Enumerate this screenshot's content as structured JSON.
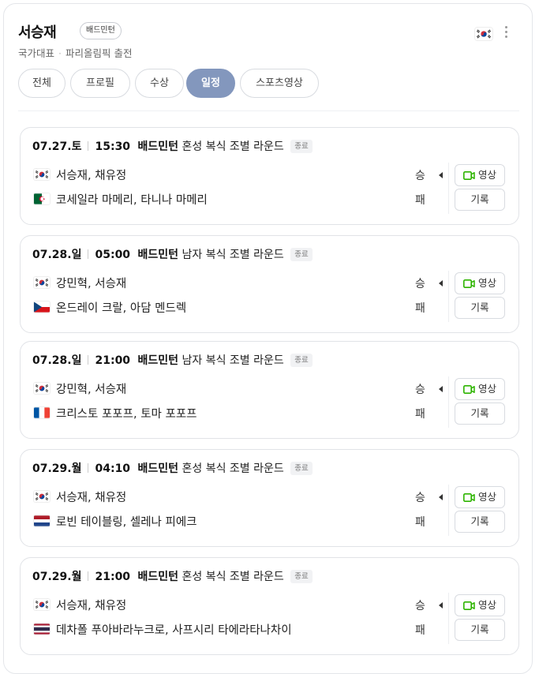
{
  "profile": {
    "name": "서승재",
    "sport_badge": "배드민턴",
    "subtitle_1": "국가대표",
    "subtitle_2": "파리올림픽 출전",
    "flag": "kr-flag-icon",
    "menu_icon": "more-vertical-icon"
  },
  "tabs": [
    {
      "label": "전체",
      "active": false
    },
    {
      "label": "프로필",
      "active": false
    },
    {
      "label": "수상",
      "active": false
    },
    {
      "label": "일정",
      "active": true
    },
    {
      "label": "스포츠영상",
      "active": false
    }
  ],
  "colors": {
    "accent": "#8397bd",
    "video_icon": "#2db400"
  },
  "matches": [
    {
      "date": "07.27.토",
      "time": "15:30",
      "sport": "배드민턴",
      "event": "혼성 복식 조별 라운드",
      "status": "종료",
      "team1": {
        "flag": "kr-flag-icon",
        "players": "서승재, 채유정",
        "result": "승"
      },
      "team2": {
        "flag": "dz-flag-icon",
        "players": "코세일라 마메리, 타니나 마메리",
        "result": "패"
      },
      "video_label": "영상",
      "record_label": "기록"
    },
    {
      "date": "07.28.일",
      "time": "05:00",
      "sport": "배드민턴",
      "event": "남자 복식 조별 라운드",
      "status": "종료",
      "team1": {
        "flag": "kr-flag-icon",
        "players": "강민혁, 서승재",
        "result": "승"
      },
      "team2": {
        "flag": "cz-flag-icon",
        "players": "온드레이 크랄, 아담 멘드렉",
        "result": "패"
      },
      "video_label": "영상",
      "record_label": "기록"
    },
    {
      "date": "07.28.일",
      "time": "21:00",
      "sport": "배드민턴",
      "event": "남자 복식 조별 라운드",
      "status": "종료",
      "team1": {
        "flag": "kr-flag-icon",
        "players": "강민혁, 서승재",
        "result": "승"
      },
      "team2": {
        "flag": "fr-flag-icon",
        "players": "크리스토 포포프, 토마 포포프",
        "result": "패"
      },
      "video_label": "영상",
      "record_label": "기록"
    },
    {
      "date": "07.29.월",
      "time": "04:10",
      "sport": "배드민턴",
      "event": "혼성 복식 조별 라운드",
      "status": "종료",
      "team1": {
        "flag": "kr-flag-icon",
        "players": "서승재, 채유정",
        "result": "승"
      },
      "team2": {
        "flag": "nl-flag-icon",
        "players": "로빈 테이블링, 셀레나 피에크",
        "result": "패"
      },
      "video_label": "영상",
      "record_label": "기록"
    },
    {
      "date": "07.29.월",
      "time": "21:00",
      "sport": "배드민턴",
      "event": "혼성 복식 조별 라운드",
      "status": "종료",
      "team1": {
        "flag": "kr-flag-icon",
        "players": "서승재, 채유정",
        "result": "승"
      },
      "team2": {
        "flag": "th-flag-icon",
        "players": "데차폴 푸아바라누크로, 사프시리 타에라타나차이",
        "result": "패"
      },
      "video_label": "영상",
      "record_label": "기록"
    }
  ]
}
